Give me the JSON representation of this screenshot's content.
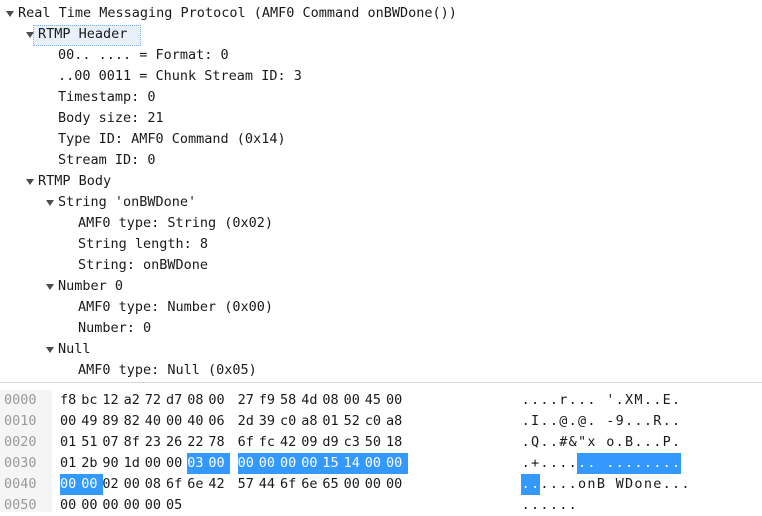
{
  "tree": [
    {
      "text": "Real Time Messaging Protocol (AMF0 Command onBWDone())",
      "depth": 0,
      "expandable": true,
      "name": "rtmp-protocol"
    },
    {
      "text": "RTMP Header",
      "depth": 1,
      "expandable": true,
      "name": "rtmp-header",
      "selected": true
    },
    {
      "text": "00.. .... = Format: 0",
      "depth": 2,
      "expandable": false,
      "name": "format-field"
    },
    {
      "text": "..00 0011 = Chunk Stream ID: 3",
      "depth": 2,
      "expandable": false,
      "name": "chunk-stream-id-field"
    },
    {
      "text": "Timestamp: 0",
      "depth": 2,
      "expandable": false,
      "name": "timestamp-field"
    },
    {
      "text": "Body size: 21",
      "depth": 2,
      "expandable": false,
      "name": "body-size-field"
    },
    {
      "text": "Type ID: AMF0 Command (0x14)",
      "depth": 2,
      "expandable": false,
      "name": "type-id-field"
    },
    {
      "text": "Stream ID: 0",
      "depth": 2,
      "expandable": false,
      "name": "stream-id-field"
    },
    {
      "text": "RTMP Body",
      "depth": 1,
      "expandable": true,
      "name": "rtmp-body"
    },
    {
      "text": "String 'onBWDone'",
      "depth": 2,
      "expandable": true,
      "name": "string-onbwdone"
    },
    {
      "text": "AMF0 type: String (0x02)",
      "depth": 3,
      "expandable": false,
      "name": "amf0-type-string"
    },
    {
      "text": "String length: 8",
      "depth": 3,
      "expandable": false,
      "name": "string-length-field"
    },
    {
      "text": "String: onBWDone",
      "depth": 3,
      "expandable": false,
      "name": "string-value-field"
    },
    {
      "text": "Number 0",
      "depth": 2,
      "expandable": true,
      "name": "number-0"
    },
    {
      "text": "AMF0 type: Number (0x00)",
      "depth": 3,
      "expandable": false,
      "name": "amf0-type-number"
    },
    {
      "text": "Number: 0",
      "depth": 3,
      "expandable": false,
      "name": "number-value-field"
    },
    {
      "text": "Null",
      "depth": 2,
      "expandable": true,
      "name": "null-node"
    },
    {
      "text": "AMF0 type: Null (0x05)",
      "depth": 3,
      "expandable": false,
      "name": "amf0-type-null"
    }
  ],
  "hex": [
    {
      "offset": "0000",
      "bytes": [
        "f8",
        "bc",
        "12",
        "a2",
        "72",
        "d7",
        "08",
        "00",
        "27",
        "f9",
        "58",
        "4d",
        "08",
        "00",
        "45",
        "00"
      ],
      "ascii": "....r... '.XM..E.",
      "hl": []
    },
    {
      "offset": "0010",
      "bytes": [
        "00",
        "49",
        "89",
        "82",
        "40",
        "00",
        "40",
        "06",
        "2d",
        "39",
        "c0",
        "a8",
        "01",
        "52",
        "c0",
        "a8"
      ],
      "ascii": ".I..@.@. -9...R..",
      "hl": []
    },
    {
      "offset": "0020",
      "bytes": [
        "01",
        "51",
        "07",
        "8f",
        "23",
        "26",
        "22",
        "78",
        "6f",
        "fc",
        "42",
        "09",
        "d9",
        "c3",
        "50",
        "18"
      ],
      "ascii": ".Q..#&\"x o.B...P.",
      "hl": []
    },
    {
      "offset": "0030",
      "bytes": [
        "01",
        "2b",
        "90",
        "1d",
        "00",
        "00",
        "03",
        "00",
        "00",
        "00",
        "00",
        "00",
        "15",
        "14",
        "00",
        "00"
      ],
      "ascii": ".+...... ........",
      "hl": [
        6,
        7,
        8,
        9,
        10,
        11,
        12,
        13,
        14,
        15
      ]
    },
    {
      "offset": "0040",
      "bytes": [
        "00",
        "00",
        "02",
        "00",
        "08",
        "6f",
        "6e",
        "42",
        "57",
        "44",
        "6f",
        "6e",
        "65",
        "00",
        "00",
        "00"
      ],
      "ascii": "......onB WDone...",
      "hl": [
        0,
        1
      ]
    },
    {
      "offset": "0050",
      "bytes": [
        "00",
        "00",
        "00",
        "00",
        "00",
        "05"
      ],
      "ascii": "......",
      "hl": []
    }
  ],
  "colors": {
    "highlight": "#3399ff",
    "selection_bg": "#e8f1fb",
    "offset_text": "#9a9a9a"
  }
}
